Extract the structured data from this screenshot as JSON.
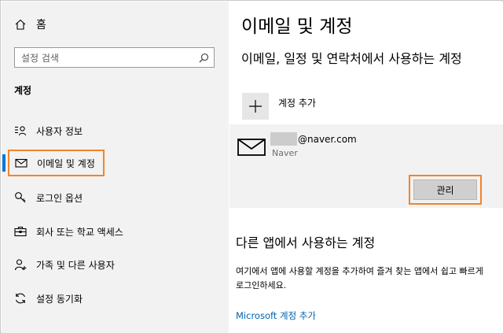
{
  "sidebar": {
    "home_label": "홈",
    "search_placeholder": "설정 검색",
    "section_title": "계정",
    "items": [
      {
        "label": "사용자 정보",
        "icon": "user-info-icon"
      },
      {
        "label": "이메일 및 계정",
        "icon": "mail-icon",
        "selected": true
      },
      {
        "label": "로그인 옵션",
        "icon": "key-icon"
      },
      {
        "label": "회사 또는 학교 액세스",
        "icon": "briefcase-icon"
      },
      {
        "label": "가족 및 다른 사용자",
        "icon": "person-add-icon"
      },
      {
        "label": "설정 동기화",
        "icon": "sync-icon"
      }
    ]
  },
  "main": {
    "title": "이메일 및 계정",
    "subheading": "이메일, 일정 및 연락처에서 사용하는 계정",
    "add_account_label": "계정 추가",
    "account": {
      "email": "@naver.com",
      "provider": "Naver",
      "manage_label": "관리"
    },
    "other_apps_heading": "다른 앱에서 사용하는 계정",
    "other_apps_description": "여기에서 앱에 사용할 계정을 추가하여 즐겨 찾는 앱에서 쉽고 빠르게 로그인하세요.",
    "ms_link": "Microsoft 계정 추가"
  },
  "colors": {
    "accent": "#0078d7",
    "highlight_outline": "#f0852b",
    "link": "#0063b1",
    "sidebar_bg": "#f2f2f2"
  }
}
